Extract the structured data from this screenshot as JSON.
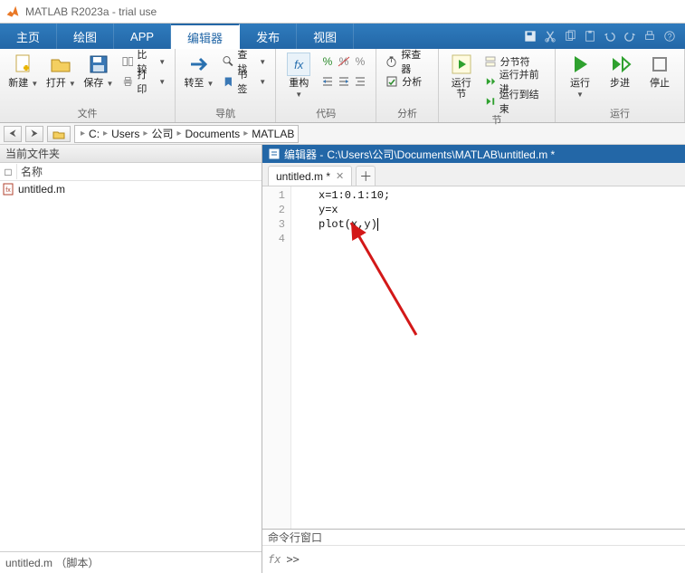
{
  "app": {
    "title": "MATLAB R2023a - trial use"
  },
  "tabs": {
    "items": [
      "主页",
      "绘图",
      "APP",
      "编辑器",
      "发布",
      "视图"
    ],
    "active_index": 3
  },
  "ribbon": {
    "groups": {
      "file": {
        "label": "文件",
        "new": "新建",
        "open": "打开",
        "save": "保存",
        "compare": "比较",
        "print": "打印"
      },
      "nav": {
        "label": "导航",
        "goto": "转至",
        "find": "查找",
        "bookmark": "书签"
      },
      "code": {
        "label": "代码",
        "refactor": "重构",
        "fx": "fx"
      },
      "analyze": {
        "label": "分析",
        "explorer": "探查器",
        "analyzer": "分析"
      },
      "section": {
        "label": "节",
        "run_section": "运行\n节",
        "section_break": "分节符",
        "run_advance": "运行并前进",
        "run_to_end": "运行到结束"
      },
      "run": {
        "label": "运行",
        "run": "运行",
        "step": "步进",
        "stop": "停止"
      }
    }
  },
  "path": {
    "crumbs": [
      "C:",
      "Users",
      "公司",
      "Documents",
      "MATLAB"
    ]
  },
  "current_folder": {
    "title": "当前文件夹",
    "columns": {
      "name": "名称"
    },
    "items": [
      {
        "name": "untitled.m"
      }
    ]
  },
  "left_status": "untitled.m （脚本）",
  "editor": {
    "title_prefix": "编辑器 - ",
    "title_path": "C:\\Users\\公司\\Documents\\MATLAB\\untitled.m *",
    "tab_label": "untitled.m *",
    "lines": [
      "x=1:0.1:10;",
      "y=x",
      "plot(x,y)"
    ],
    "line_count": 4
  },
  "command_window": {
    "title": "命令行窗口",
    "prompt": ">>",
    "fx": "fx"
  }
}
